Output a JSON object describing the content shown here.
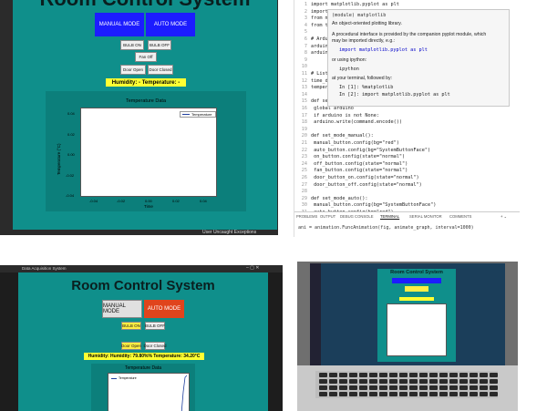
{
  "panelA": {
    "title": "Room Control System",
    "manual_mode": "MANUAL MODE",
    "auto_mode": "AUTO MODE",
    "bulb_on": "BULB ON",
    "bulb_off": "BULB OFF",
    "fan_off": "Fan Off",
    "door_open": "Door Open",
    "door_closed": "Door Closed",
    "status": "Humidity: - Temperature: -",
    "chart_title": "Temperature Data",
    "legend": "Temperature",
    "ylabel": "Temperature (°C)",
    "xlabel": "Time",
    "y_ticks": [
      "0.04",
      "0.02",
      "0.00",
      "-0.02",
      "-0.04"
    ],
    "x_ticks": [
      "-0.04",
      "-0.02",
      "0.00",
      "0.02",
      "0.04"
    ],
    "checkbox_label": "User Uncaught Exceptions",
    "colors": {
      "bg": "#0f8f8b",
      "manual": "#1c1cff",
      "auto": "#1c1cff",
      "status": "#ffff33"
    }
  },
  "panelB": {
    "code": [
      {
        "n": "1",
        "t": "import matplotlib.pyplot as plt"
      },
      {
        "n": "2",
        "t": "import "
      },
      {
        "n": "3",
        "t": "from ma"
      },
      {
        "n": "4",
        "t": "from tk"
      },
      {
        "n": "5",
        "t": ""
      },
      {
        "n": "6",
        "t": "# Ardui"
      },
      {
        "n": "7",
        "t": "arduino"
      },
      {
        "n": "8",
        "t": "arduino"
      },
      {
        "n": "9",
        "t": ""
      },
      {
        "n": "10",
        "t": ""
      },
      {
        "n": "11",
        "t": "# Lists"
      },
      {
        "n": "12",
        "t": "time_da"
      },
      {
        "n": "13",
        "t": "tempera"
      },
      {
        "n": "14",
        "t": ""
      },
      {
        "n": "15",
        "t": "def ser"
      },
      {
        "n": "16",
        "t": "    global arduino"
      },
      {
        "n": "17",
        "t": "    if arduino is not None:"
      },
      {
        "n": "18",
        "t": "        arduino.write(command.encode())"
      },
      {
        "n": "19",
        "t": ""
      },
      {
        "n": "20",
        "t": "def set_mode_manual():"
      },
      {
        "n": "21",
        "t": "    manual_button.config(bg=\"red\")"
      },
      {
        "n": "22",
        "t": "    auto_button.config(bg=\"SystemButtonFace\")"
      },
      {
        "n": "23",
        "t": "    on_button.config(state=\"normal\")"
      },
      {
        "n": "24",
        "t": "    off_button.config(state=\"normal\")"
      },
      {
        "n": "25",
        "t": "    fan_button.config(state=\"normal\")"
      },
      {
        "n": "26",
        "t": "    door_button_on.config(state=\"normal\")"
      },
      {
        "n": "27",
        "t": "    door_button_off.config(state=\"normal\")"
      },
      {
        "n": "28",
        "t": ""
      },
      {
        "n": "29",
        "t": "def set_mode_auto():"
      },
      {
        "n": "30",
        "t": "    manual_button.config(bg=\"SystemButtonFace\")"
      },
      {
        "n": "31",
        "t": "    auto_button.config(bg=\"red\")"
      }
    ],
    "tooltip": {
      "module": "(module) matplotlib",
      "line1": "An object-oriented plotting library.",
      "line2": "A procedural interface is provided by the companion pyplot module, which",
      "line3": "may be imported directly, e.g.:",
      "code1": "import matplotlib.pyplot as plt",
      "line4": "or using ipython:",
      "code2": "ipython",
      "line5": "at your terminal, followed by:",
      "code3": "In [1]: %matplotlib",
      "code4": "In [2]: import matplotlib.pyplot as plt"
    },
    "tabs": [
      "PROBLEMS",
      "OUTPUT",
      "DEBUG CONSOLE",
      "TERMINAL",
      "SERIAL MONITOR",
      "COMMENTS"
    ],
    "terminal_line": "ani = animation.FuncAnimation(fig, animate_graph, interval=1000)"
  },
  "panelC": {
    "window_title": "Data Acquisition System",
    "title": "Room Control System",
    "manual_mode": "MANUAL MODE",
    "auto_mode": "AUTO MODE",
    "bulb_on": "BULB ON",
    "bulb_off": "BULB OFF",
    "door_open": "Door Open",
    "door_closed": "Door Closed",
    "status": "Humidity: Humidity: 79.80%% Temperature: 34.20°C",
    "chart_title": "Temperature Data",
    "legend": "Temperature",
    "colors": {
      "manual": "#e0e0e0",
      "auto": "#e0441c",
      "status": "#ffff33"
    }
  },
  "panelD": {
    "title": "Room Control System"
  }
}
